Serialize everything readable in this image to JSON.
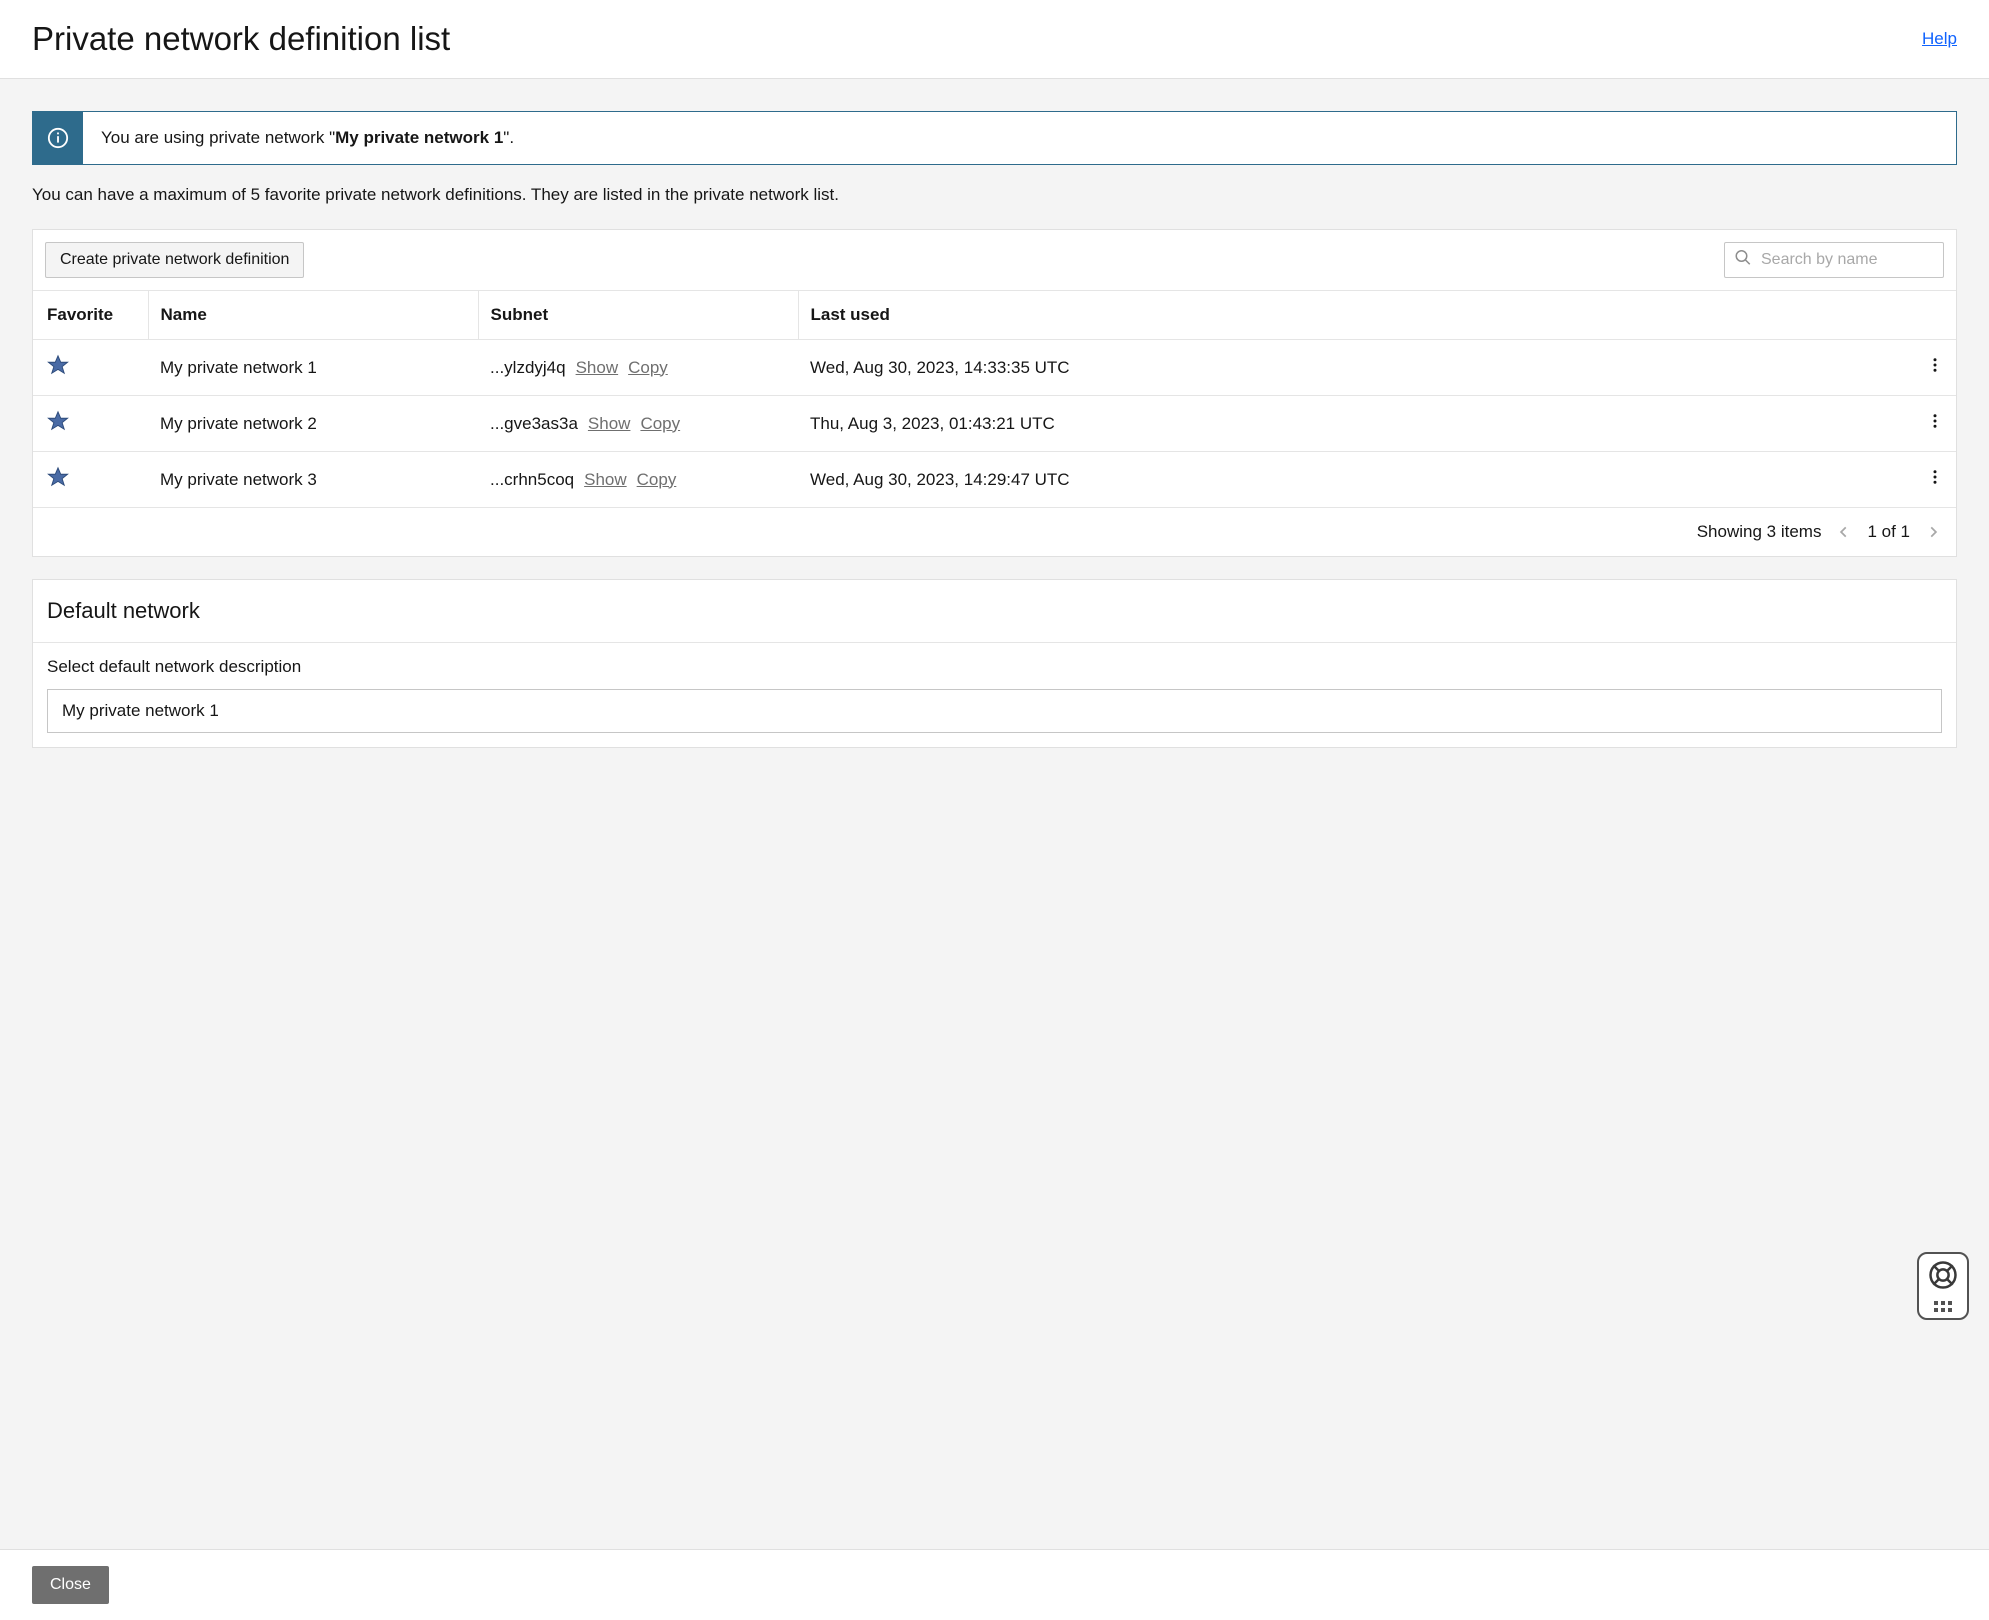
{
  "header": {
    "title": "Private network definition list",
    "help_label": "Help"
  },
  "banner": {
    "prefix": "You are using private network \"",
    "network_name": "My private network 1",
    "suffix": "\"."
  },
  "subtitle": "You can have a maximum of 5 favorite private network definitions. They are listed in the private network list.",
  "toolbar": {
    "create_label": "Create private network definition",
    "search_placeholder": "Search by name"
  },
  "table": {
    "columns": {
      "favorite": "Favorite",
      "name": "Name",
      "subnet": "Subnet",
      "last_used": "Last used"
    },
    "show_label": "Show",
    "copy_label": "Copy",
    "rows": [
      {
        "name": "My private network 1",
        "subnet_fragment": "...ylzdyj4q",
        "last_used": "Wed, Aug 30, 2023, 14:33:35 UTC"
      },
      {
        "name": "My private network 2",
        "subnet_fragment": "...gve3as3a",
        "last_used": "Thu, Aug 3, 2023, 01:43:21 UTC"
      },
      {
        "name": "My private network 3",
        "subnet_fragment": "...crhn5coq",
        "last_used": "Wed, Aug 30, 2023, 14:29:47 UTC"
      }
    ]
  },
  "pagination": {
    "showing": "Showing 3 items",
    "page": "1 of 1"
  },
  "default_card": {
    "title": "Default network",
    "description": "Select default network description",
    "selected": "My private network 1"
  },
  "footer": {
    "close_label": "Close"
  },
  "colors": {
    "banner_accent": "#2e6b8c",
    "link_blue": "#0f62fe",
    "star_fill": "#4a6ba5"
  }
}
